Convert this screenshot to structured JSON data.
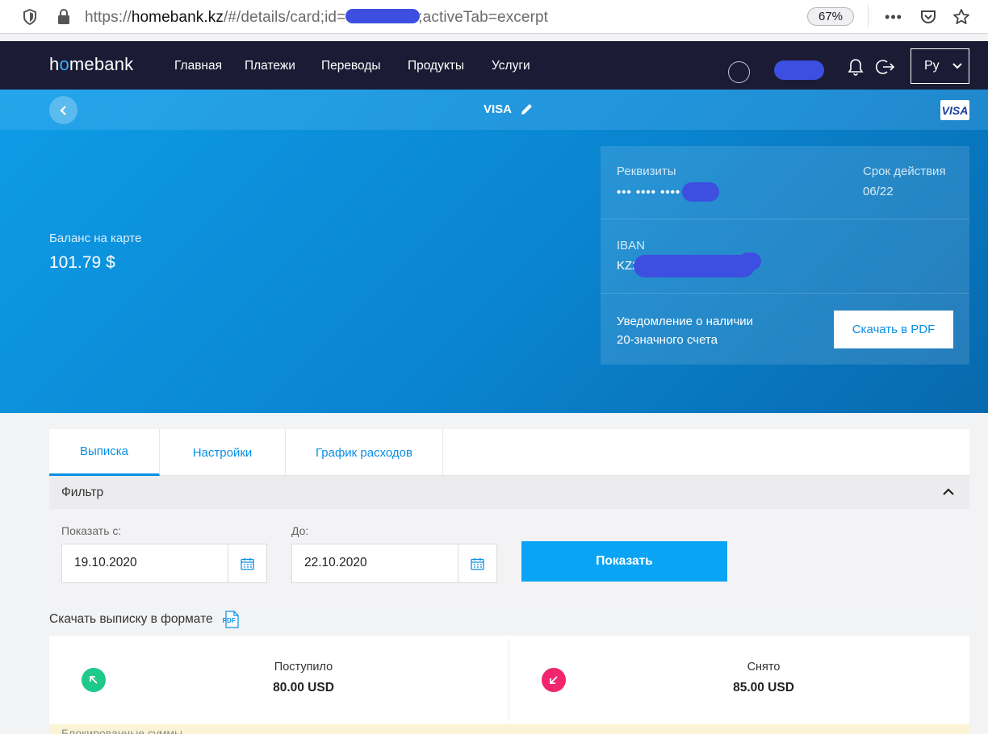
{
  "browser": {
    "url_prefix": "https://",
    "url_host": "homebank.kz",
    "url_path": "/#/details/card;id=",
    "url_tail": ";activeTab=excerpt",
    "zoom": "67%"
  },
  "nav": {
    "logo_h": "h",
    "logo_o": "o",
    "logo_rest": "mebank",
    "items": [
      "Главная",
      "Платежи",
      "Переводы",
      "Продукты",
      "Услуги"
    ],
    "lang": "Ру"
  },
  "card": {
    "title": "VISA",
    "visa_logo": "VISA",
    "balance_label": "Баланс на карте",
    "balance_value": "101.79 $"
  },
  "details": {
    "requisites_label": "Реквизиты",
    "requisites_value": "••• •••• ••••",
    "expiry_label": "Срок действия",
    "expiry_value": "06/22",
    "iban_label": "IBAN",
    "iban_value": "KZ2",
    "notice_line1": "Уведомление о наличии",
    "notice_line2": "20-значного счета",
    "pdf_button": "Скачать в PDF"
  },
  "tabs": [
    "Выписка",
    "Настройки",
    "График расходов"
  ],
  "filter": {
    "title": "Фильтр",
    "from_label": "Показать с:",
    "from_value": "19.10.2020",
    "to_label": "До:",
    "to_value": "22.10.2020",
    "show_button": "Показать"
  },
  "download": {
    "label": "Скачать выписку в формате",
    "format": "PDF"
  },
  "summary": {
    "in_label": "Поступило",
    "in_value": "80.00 USD",
    "out_label": "Снято",
    "out_value": "85.00 USD"
  },
  "blocked_label": "Блокированные суммы",
  "colors": {
    "accent": "#0a8ee3",
    "nav_bg": "#1b1b36",
    "incoming": "#1ec98a",
    "outgoing": "#f0266e"
  }
}
